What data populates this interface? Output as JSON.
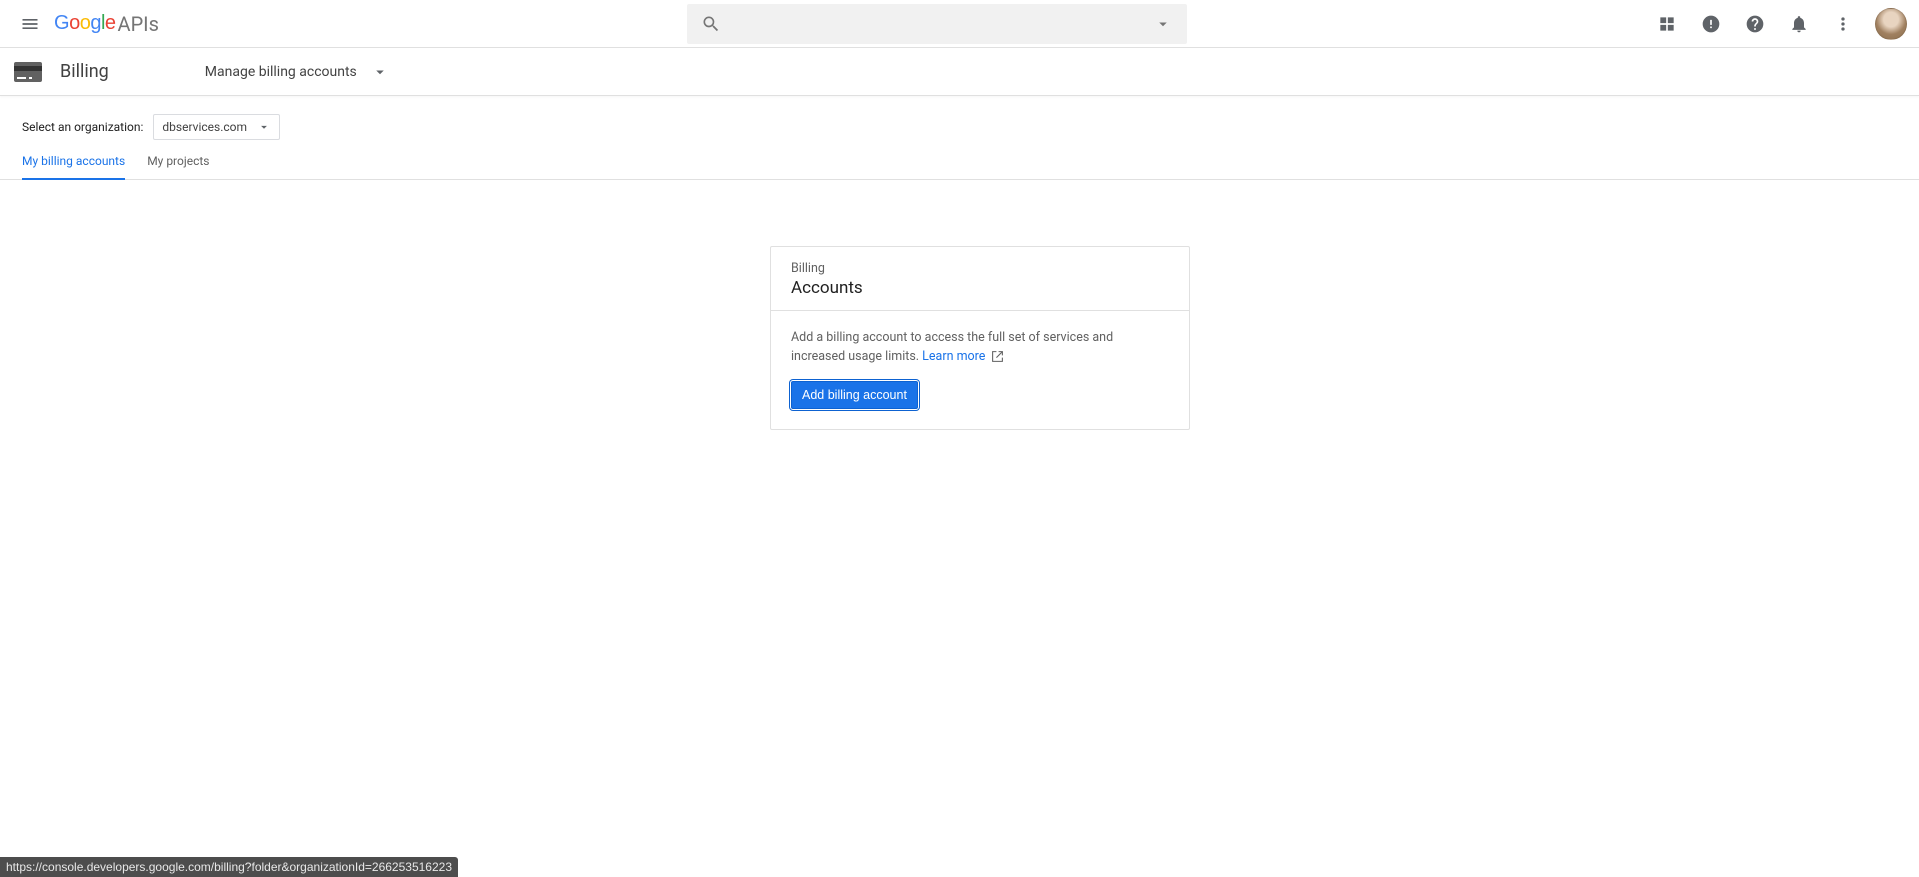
{
  "header": {
    "logo_apis": "APIs",
    "search_placeholder": ""
  },
  "subheader": {
    "title": "Billing",
    "manage_label": "Manage billing accounts"
  },
  "org": {
    "label": "Select an organization:",
    "selected": "dbservices.com"
  },
  "tabs": {
    "my_billing": "My billing accounts",
    "my_projects": "My projects"
  },
  "card": {
    "eyebrow": "Billing",
    "title": "Accounts",
    "description": "Add a billing account to access the full set of services and increased usage limits. ",
    "learn_more": "Learn more",
    "add_button": "Add billing account"
  },
  "status_url": "https://console.developers.google.com/billing?folder&organizationId=266253516223"
}
